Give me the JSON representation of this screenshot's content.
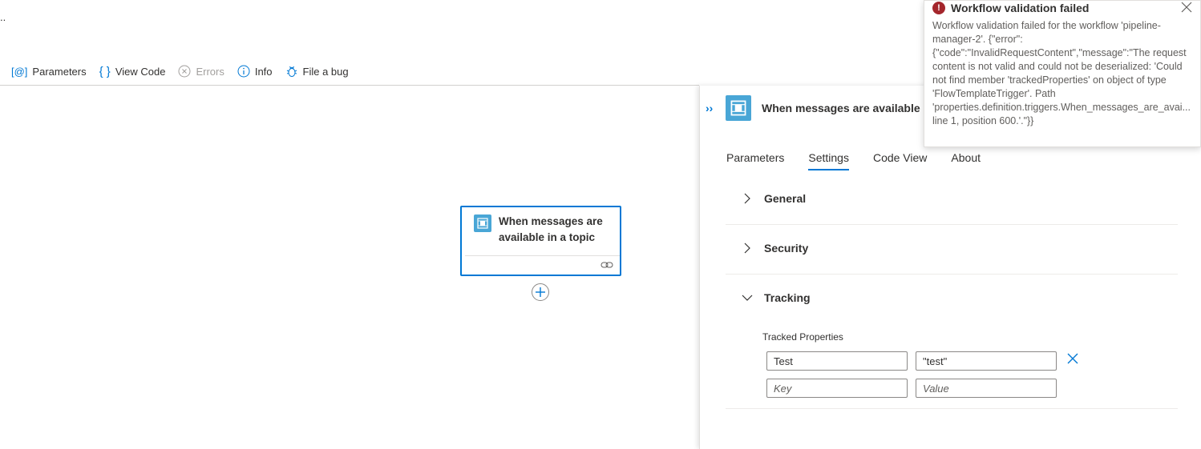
{
  "page": {
    "truncated_text": ".."
  },
  "toolbar": {
    "items": [
      {
        "label": "Parameters",
        "icon": "parameters-icon",
        "disabled": false
      },
      {
        "label": "View Code",
        "icon": "code-braces-icon",
        "disabled": false
      },
      {
        "label": "Errors",
        "icon": "error-circle-icon",
        "disabled": true
      },
      {
        "label": "Info",
        "icon": "info-icon",
        "disabled": false
      },
      {
        "label": "File a bug",
        "icon": "bug-icon",
        "disabled": false
      }
    ]
  },
  "canvas": {
    "card_title": "When messages are available in a topic"
  },
  "panel": {
    "title": "When messages are available in a topic",
    "tabs": [
      {
        "label": "Parameters",
        "active": false
      },
      {
        "label": "Settings",
        "active": true
      },
      {
        "label": "Code View",
        "active": false
      },
      {
        "label": "About",
        "active": false
      }
    ],
    "sections": [
      {
        "title": "General",
        "expanded": false
      },
      {
        "title": "Security",
        "expanded": false
      },
      {
        "title": "Tracking",
        "expanded": true
      }
    ],
    "tracking": {
      "label": "Tracked Properties",
      "rows": [
        {
          "key": "Test",
          "value": "\"test\""
        }
      ],
      "key_placeholder": "Key",
      "value_placeholder": "Value"
    }
  },
  "toast": {
    "title": "Workflow validation failed",
    "message": "Workflow validation failed for the workflow 'pipeline-manager-2'. {\"error\":{\"code\":\"InvalidRequestContent\",\"message\":\"The request content is not valid and could not be deserialized: 'Could not find member 'trackedProperties' on object of type 'FlowTemplateTrigger'. Path 'properties.definition.triggers.When_messages_are_avai... line 1, position 600.'.\"}}"
  },
  "colors": {
    "accent": "#0078d4",
    "connector": "#49a6d6",
    "error": "#a4262c"
  }
}
